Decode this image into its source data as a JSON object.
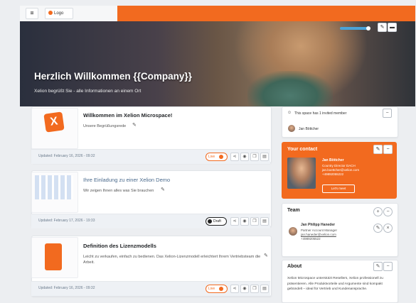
{
  "topbar": {
    "grid_label": "⊞",
    "logo_label": "Logo"
  },
  "hero": {
    "title": "Herzlich Willkommen {{Company}}",
    "subtitle": "Xelion begrüßt Sie - alle Informationen an einem Ort"
  },
  "cards": [
    {
      "title": "Willkommen im Xelion Microspace!",
      "text": "Unsere Begrüßungsrede",
      "updated": "Updated: February 16, 2026 - 09:32",
      "status": "Live"
    },
    {
      "title": "Ihre Einladung zu einer Xelion Demo",
      "text": "Wir zeigen Ihnen alles was Sie brauchen",
      "updated": "Updated: February 17, 2026 - 19:33",
      "status": "Draft"
    },
    {
      "title": "Definition des Lizenzmodells",
      "text": "Leicht zu verkaufen, einfach zu bedienen. Das Xelion-Lizenzmodell erleichtert Ihrem Vertriebsteam die Arbeit.",
      "updated": "Updated: February 16, 2026 - 09:32",
      "status": "Live"
    }
  ],
  "invite": {
    "text": "This space has 1 invited member",
    "member": "Jan Böttcher"
  },
  "contact": {
    "title": "Your contact",
    "name": "Jan Böttcher",
    "role": "Country Director DACH",
    "email": "jan.boettcher@xelion.com",
    "phone": "+49892055222",
    "button": "Let's meet"
  },
  "team": {
    "title": "Team",
    "name": "Jan Philipp Haneder",
    "role": "Partner Account Manager",
    "email": "jan.haneder@xelion.com",
    "phone": "+4989205522"
  },
  "about": {
    "title": "About",
    "text": "Xelion Microspace unterstützt Resellers, Xelion professionell zu präsentieren. Alle Produktvorteile und Argumente sind kompakt gebündelt – ideal für Vertrieb und Kundenansprache."
  },
  "colors": {
    "accent": "#f26a1f",
    "hero_toggle": "#4aa3d8"
  }
}
